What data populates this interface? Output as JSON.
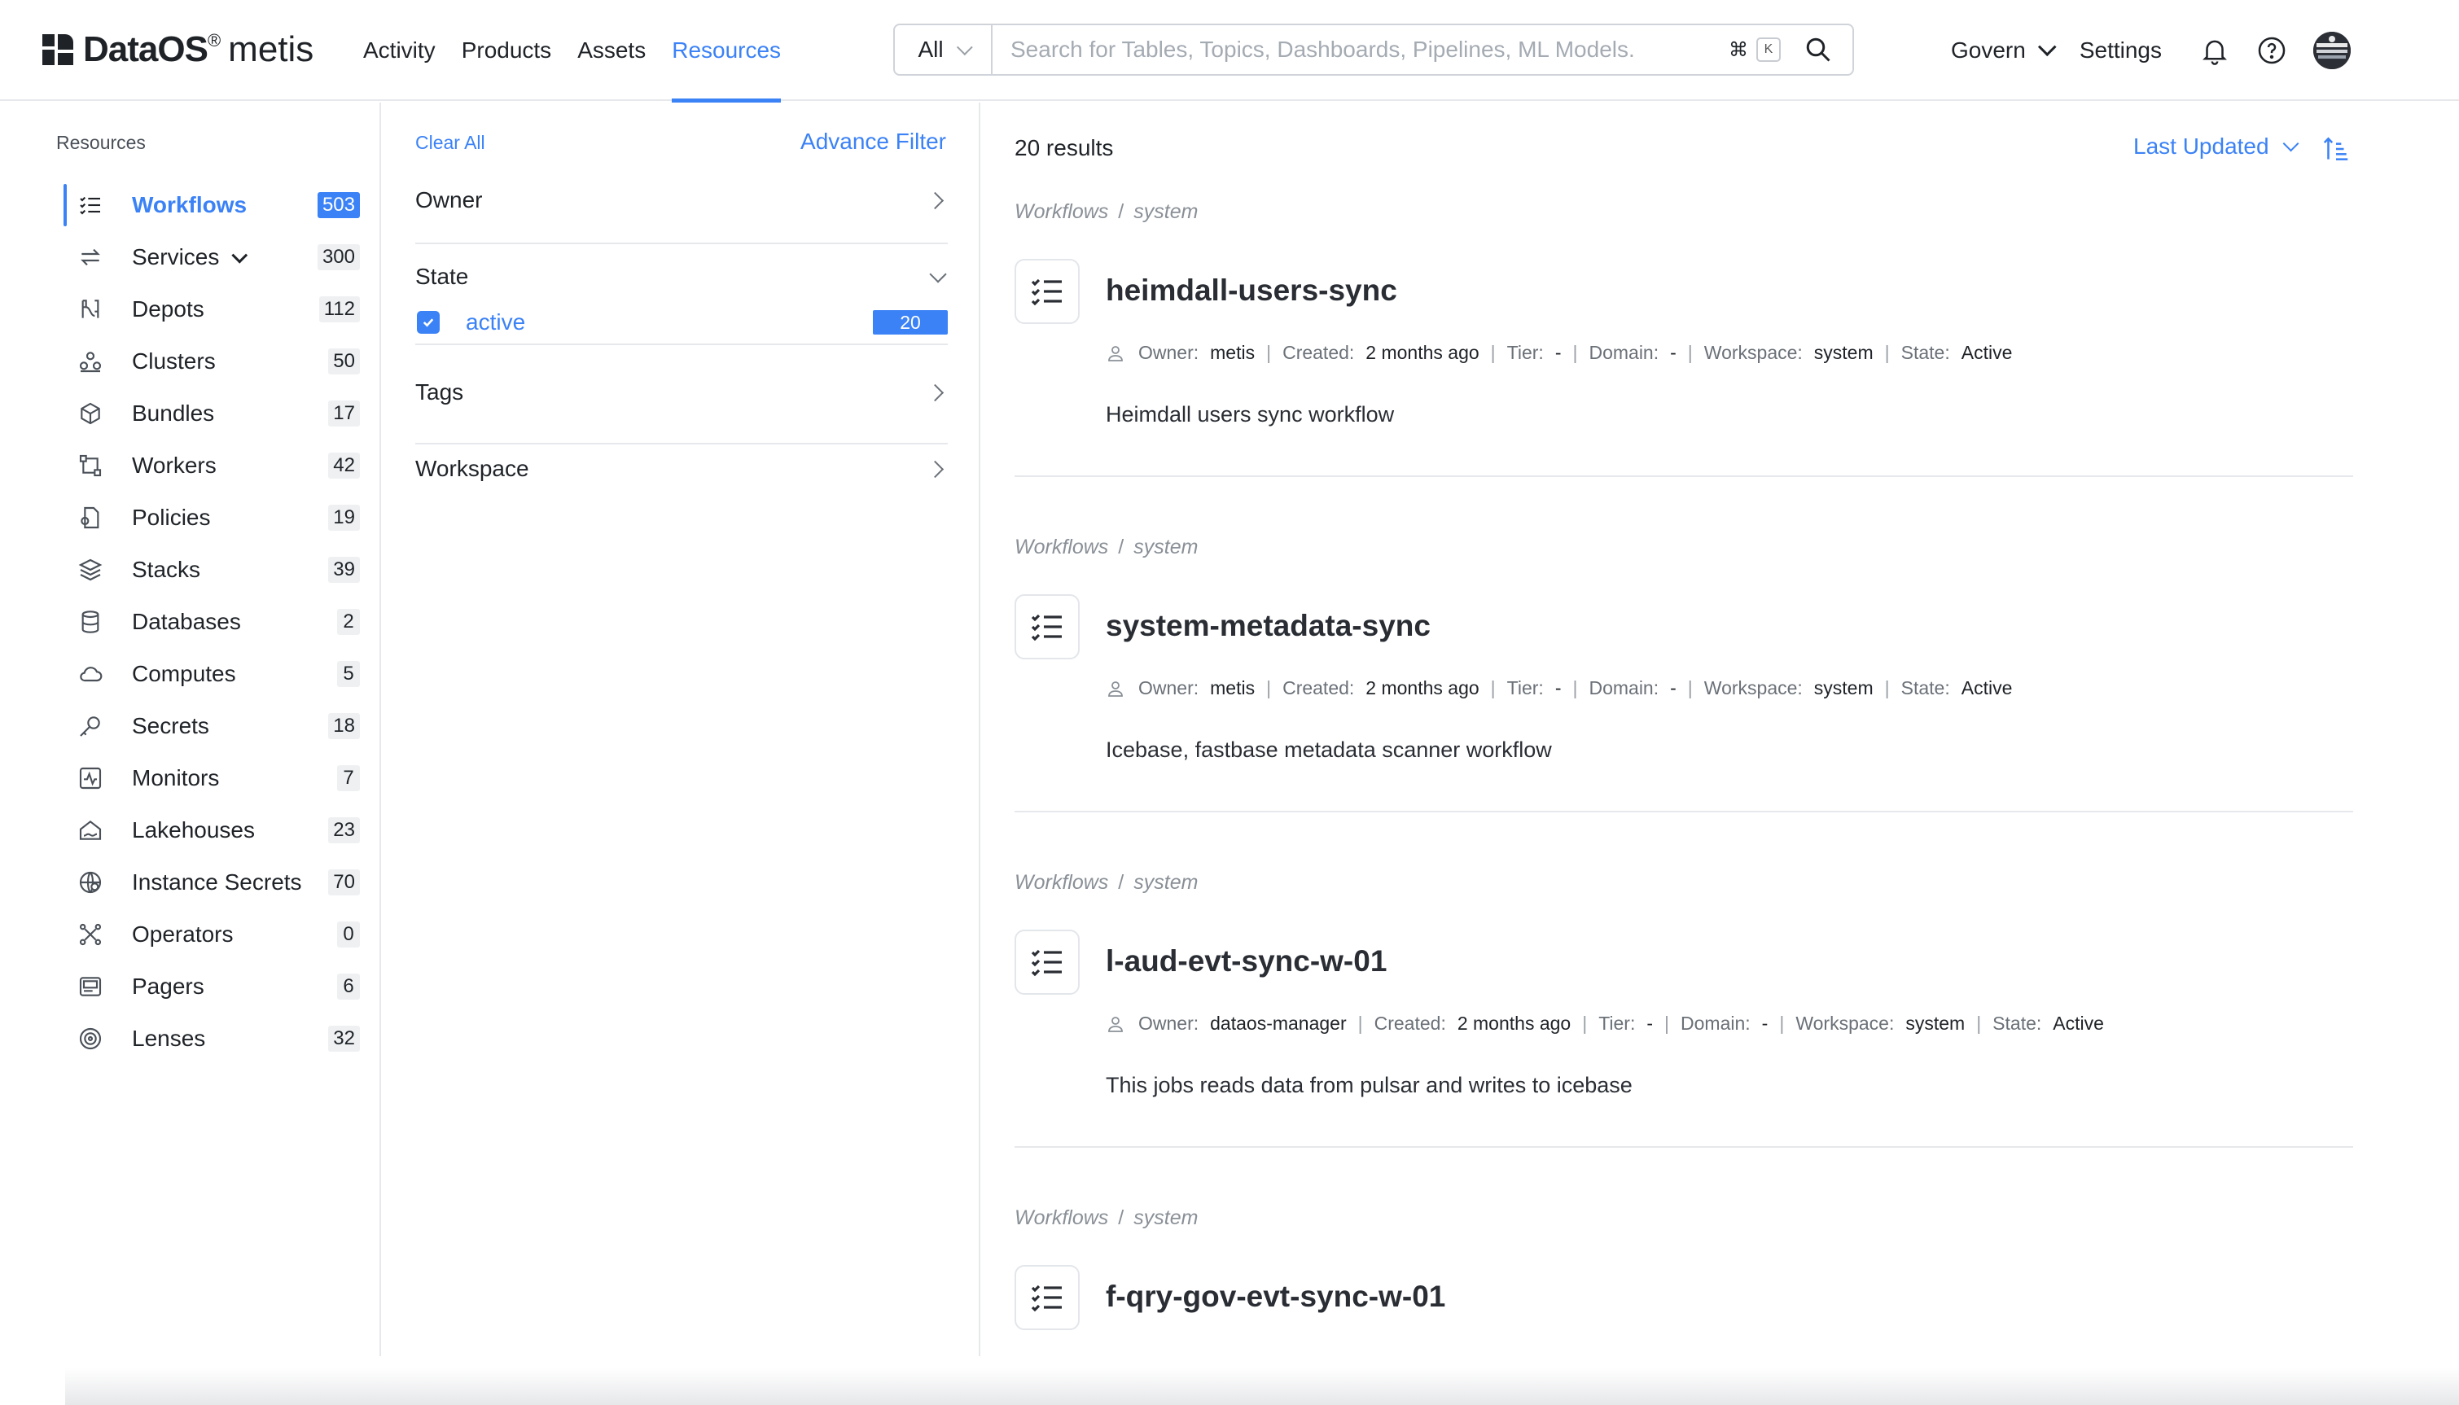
{
  "header": {
    "logo_text": "DataOS",
    "logo_reg": "®",
    "logo_product": "metis",
    "nav": [
      {
        "label": "Activity",
        "active": false
      },
      {
        "label": "Products",
        "active": false
      },
      {
        "label": "Assets",
        "active": false
      },
      {
        "label": "Resources",
        "active": true
      }
    ],
    "search": {
      "scope": "All",
      "placeholder": "Search for Tables, Topics, Dashboards, Pipelines, ML Models.",
      "shortcut_symbol": "⌘",
      "shortcut_key": "K"
    },
    "govern_label": "Govern",
    "settings_label": "Settings",
    "icons": [
      "bell-icon",
      "help-icon",
      "avatar"
    ]
  },
  "sidebar": {
    "title": "Resources",
    "items": [
      {
        "label": "Workflows",
        "count": "503",
        "icon": "workflow-icon",
        "active": true
      },
      {
        "label": "Services",
        "count": "300",
        "icon": "services-icon",
        "expandable": true
      },
      {
        "label": "Depots",
        "count": "112",
        "icon": "depot-icon"
      },
      {
        "label": "Clusters",
        "count": "50",
        "icon": "cluster-icon"
      },
      {
        "label": "Bundles",
        "count": "17",
        "icon": "bundle-icon"
      },
      {
        "label": "Workers",
        "count": "42",
        "icon": "worker-icon"
      },
      {
        "label": "Policies",
        "count": "19",
        "icon": "policy-icon"
      },
      {
        "label": "Stacks",
        "count": "39",
        "icon": "stack-icon"
      },
      {
        "label": "Databases",
        "count": "2",
        "icon": "database-icon"
      },
      {
        "label": "Computes",
        "count": "5",
        "icon": "cloud-icon"
      },
      {
        "label": "Secrets",
        "count": "18",
        "icon": "key-icon"
      },
      {
        "label": "Monitors",
        "count": "7",
        "icon": "monitor-icon"
      },
      {
        "label": "Lakehouses",
        "count": "23",
        "icon": "lakehouse-icon"
      },
      {
        "label": "Instance Secrets",
        "count": "70",
        "icon": "globe-icon"
      },
      {
        "label": "Operators",
        "count": "0",
        "icon": "operator-icon"
      },
      {
        "label": "Pagers",
        "count": "6",
        "icon": "pager-icon"
      },
      {
        "label": "Lenses",
        "count": "32",
        "icon": "lens-icon"
      }
    ]
  },
  "filters": {
    "clear_all": "Clear All",
    "advance_filter": "Advance Filter",
    "owner": "Owner",
    "state": "State",
    "state_options": [
      {
        "label": "active",
        "count": "20",
        "checked": true
      }
    ],
    "tags": "Tags",
    "workspace": "Workspace"
  },
  "results": {
    "count_label": "20 results",
    "sort_label": "Last Updated",
    "labels": {
      "owner": "Owner:",
      "created": "Created:",
      "tier": "Tier:",
      "domain": "Domain:",
      "workspace": "Workspace:",
      "state": "State:"
    },
    "items": [
      {
        "crumb_type": "Workflows",
        "crumb_sep": "/",
        "crumb_ws": "system",
        "name": "heimdall-users-sync",
        "owner": "metis",
        "created": "2 months ago",
        "tier": "-",
        "domain": "-",
        "workspace": "system",
        "state": "Active",
        "description": "Heimdall users sync workflow"
      },
      {
        "crumb_type": "Workflows",
        "crumb_sep": "/",
        "crumb_ws": "system",
        "name": "system-metadata-sync",
        "owner": "metis",
        "created": "2 months ago",
        "tier": "-",
        "domain": "-",
        "workspace": "system",
        "state": "Active",
        "description": "Icebase, fastbase metadata scanner workflow"
      },
      {
        "crumb_type": "Workflows",
        "crumb_sep": "/",
        "crumb_ws": "system",
        "name": "l-aud-evt-sync-w-01",
        "owner": "dataos-manager",
        "created": "2 months ago",
        "tier": "-",
        "domain": "-",
        "workspace": "system",
        "state": "Active",
        "description": "This jobs reads data from pulsar and writes to icebase"
      },
      {
        "crumb_type": "Workflows",
        "crumb_sep": "/",
        "crumb_ws": "system",
        "name": "f-qry-gov-evt-sync-w-01"
      }
    ]
  }
}
